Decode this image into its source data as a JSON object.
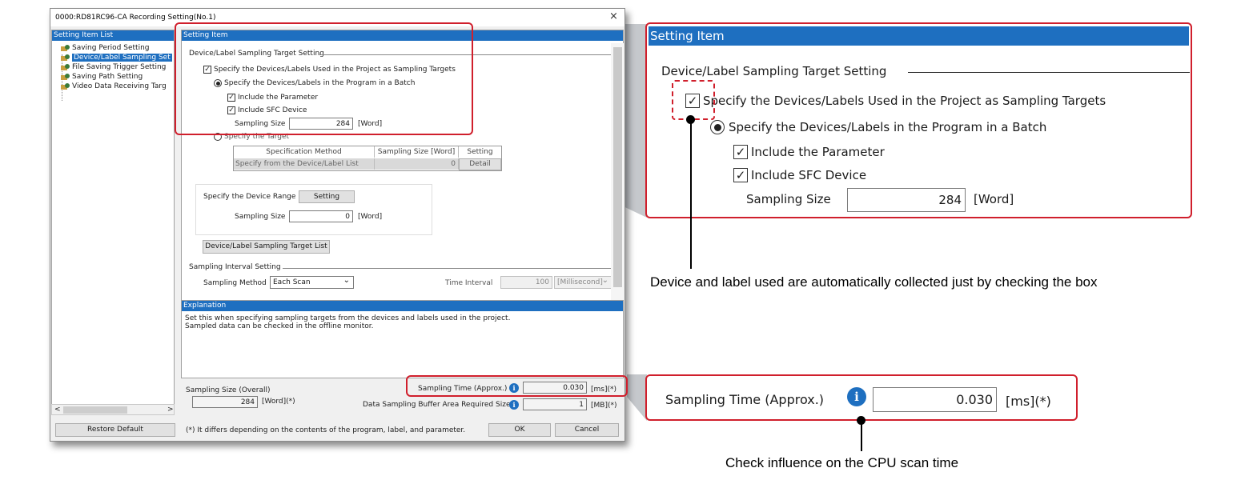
{
  "window": {
    "title": "0000:RD81RC96-CA Recording Setting(No.1)",
    "close_glyph": "×"
  },
  "left_pane": {
    "header": "Setting Item List",
    "items": [
      {
        "label": "Saving Period Setting",
        "selected": false
      },
      {
        "label": "Device/Label Sampling Set",
        "selected": true
      },
      {
        "label": "File Saving Trigger Setting",
        "selected": false
      },
      {
        "label": "Saving Path Setting",
        "selected": false
      },
      {
        "label": "Video Data Receiving Targ",
        "selected": false
      }
    ],
    "scroll_left": "<",
    "scroll_right": ">"
  },
  "setting_item": {
    "header": "Setting Item",
    "target_group": "Device/Label Sampling Target Setting",
    "specify_in_project": "Specify the Devices/Labels Used in the Project as Sampling Targets",
    "specify_in_batch": "Specify the Devices/Labels in the Program in a Batch",
    "include_parameter": "Include the Parameter",
    "include_sfc": "Include SFC Device",
    "sampling_size_label": "Sampling Size",
    "sampling_size_value": "284",
    "sampling_size_unit": "[Word]",
    "specify_target": "Specify the Target",
    "table": {
      "headers": [
        "Specification Method",
        "Sampling Size [Word]",
        "Setting"
      ],
      "row": [
        "Specify from the Device/Label List",
        "0",
        "Detail"
      ]
    },
    "device_range_label": "Specify the Device Range",
    "device_range_button": "Setting",
    "range_sampling_size_label": "Sampling Size",
    "range_sampling_size_value": "0",
    "range_sampling_size_unit": "[Word]",
    "target_list_button": "Device/Label Sampling Target List",
    "interval_group": "Sampling Interval Setting",
    "method_label": "Sampling Method",
    "method_value": "Each Scan",
    "time_interval_label": "Time Interval",
    "time_interval_value": "100",
    "time_interval_unit": "[Millisecond]"
  },
  "explanation": {
    "header": "Explanation",
    "line1": "Set this when specifying sampling targets from the devices and labels used in the project.",
    "line2": "Sampled data can be checked in the offline monitor."
  },
  "footer": {
    "overall_label": "Sampling Size (Overall)",
    "overall_value": "284",
    "overall_unit": "[Word](*)",
    "sampling_time_label": "Sampling Time (Approx.)",
    "sampling_time_value": "0.030",
    "sampling_time_unit": "[ms](*)",
    "buffer_label": "Data Sampling Buffer Area Required Size",
    "buffer_value": "1",
    "buffer_unit": "[MB](*)",
    "note": "(*) It differs depending on the contents of the program, label, and parameter.",
    "restore_button": "Restore Default",
    "ok_button": "OK",
    "cancel_button": "Cancel"
  },
  "zoom_setting": {
    "header": "Setting Item",
    "target_group": "Device/Label Sampling Target Setting",
    "specify_in_project": "Specify the Devices/Labels Used in the Project as Sampling Targets",
    "specify_in_batch": "Specify the Devices/Labels in the Program in a Batch",
    "include_parameter": "Include the Parameter",
    "include_sfc": "Include SFC Device",
    "sampling_size_label": "Sampling Size",
    "sampling_size_value": "284",
    "sampling_size_unit": "[Word]"
  },
  "zoom_time": {
    "label": "Sampling Time (Approx.)",
    "value": "0.030",
    "unit": "[ms](*)"
  },
  "captions": {
    "checkbox_note": "Device and label used are automatically collected just by checking the box",
    "scan_time_note": "Check influence on the CPU scan time"
  },
  "icons": {
    "check": "✓",
    "info": "i",
    "dropdown": "⌄"
  },
  "colors": {
    "accent_blue": "#1e6fc0",
    "highlight_red": "#d01f2c"
  }
}
